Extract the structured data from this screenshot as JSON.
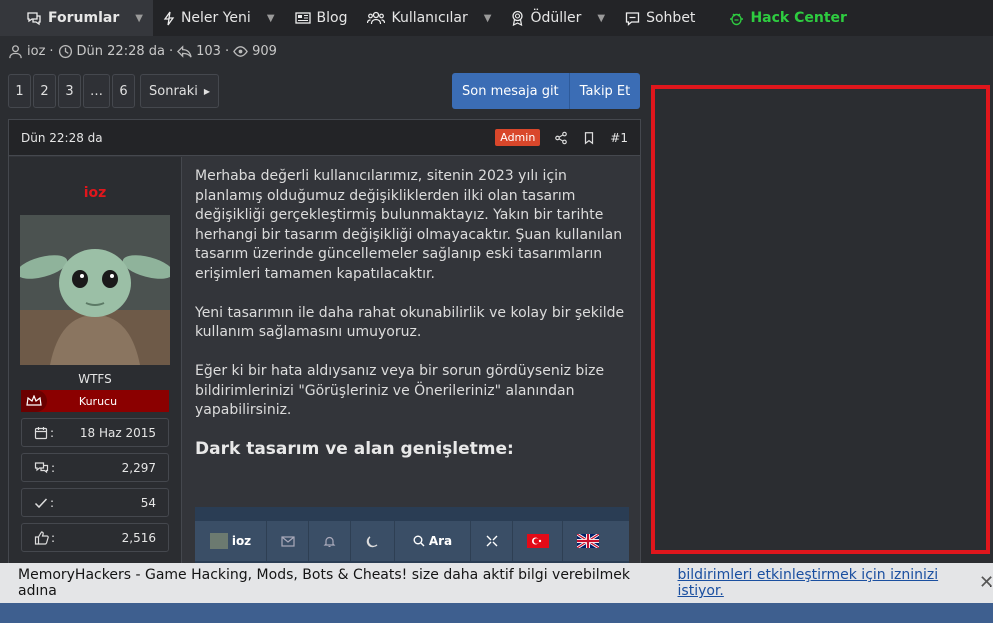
{
  "nav": {
    "items": [
      {
        "label": "Forumlar",
        "icon": "chat-icon",
        "caret": true
      },
      {
        "label": "Neler Yeni",
        "icon": "bolt-icon",
        "caret": true
      },
      {
        "label": "Blog",
        "icon": "newspaper-icon",
        "caret": false
      },
      {
        "label": "Kullanıcılar",
        "icon": "users-icon",
        "caret": true
      },
      {
        "label": "Ödüller",
        "icon": "award-icon",
        "caret": true
      },
      {
        "label": "Sohbet",
        "icon": "message-icon",
        "caret": false
      },
      {
        "label": "Hack Center",
        "icon": "bug-icon",
        "caret": false
      }
    ],
    "accent_hack": "#2ecc40"
  },
  "thread_meta": {
    "author": "ioz",
    "sep": "·",
    "date": "Dün 22:28 da",
    "replies": "103",
    "views": "909"
  },
  "pager": {
    "pages": [
      "1",
      "2",
      "3",
      "…",
      "6"
    ],
    "next": "Sonraki"
  },
  "actions": {
    "last_post": "Son mesaja git",
    "follow": "Takip Et"
  },
  "post": {
    "date": "Dün 22:28 da",
    "badge": "Admin",
    "number": "#1",
    "user": {
      "name": "ioz",
      "title": "WTFS",
      "rank": "Kurucu",
      "stats": [
        {
          "icon": "calendar-icon",
          "value": "18 Haz 2015"
        },
        {
          "icon": "messages-icon",
          "value": "2,297"
        },
        {
          "icon": "check-icon",
          "value": "54"
        },
        {
          "icon": "thumbs-up-icon",
          "value": "2,516"
        }
      ],
      "stat_sep": ":"
    },
    "paragraphs": [
      "Merhaba değerli kullanıcılarımız, sitenin 2023 yılı için planlamış olduğumuz değişikliklerden ilki olan tasarım değişikliği gerçekleştirmiş bulunmaktayız. Yakın bir tarihte herhangi bir tasarım değişikliği olmayacaktır. Şuan kullanılan tasarım üzerinde güncellemeler sağlanıp eski tasarımların erişimleri tamamen kapatılacaktır.",
      "Yeni tasarımın ile daha rahat okunabilirlik ve kolay bir şekilde kullanım sağlamasını umuyoruz.",
      "Eğer ki bir hata aldıysanız veya bir sorun gördüyseniz bize bildirimlerinizi \"Görüşleriniz ve Önerileriniz\" alanından yapabilirsiniz."
    ],
    "heading": "Dark tasarım ve alan genişletme:",
    "screenshot_bar": {
      "user": "ioz",
      "search": "Ara"
    }
  },
  "notice": {
    "text": "MemoryHackers - Game Hacking, Mods, Bots & Cheats! size daha aktif bilgi verebilmek adına",
    "link": "bildirimleri etkinleştirmek için izninizi istiyor.",
    "trail": ".",
    "close": "✕"
  }
}
